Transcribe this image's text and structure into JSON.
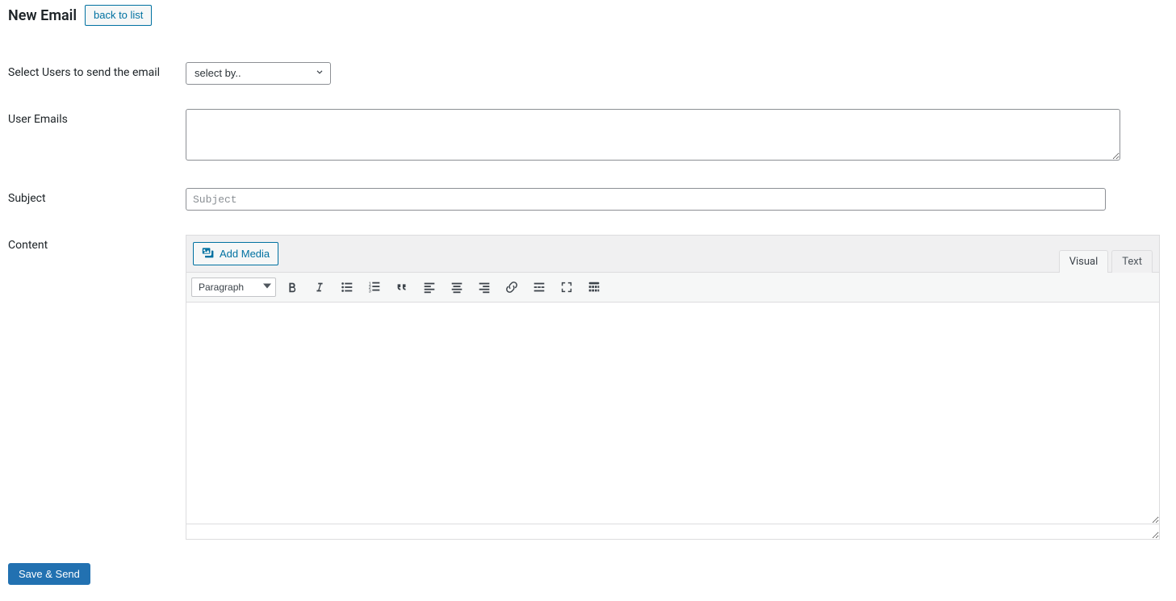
{
  "header": {
    "title": "New Email",
    "back_label": "back to list"
  },
  "fields": {
    "select_users_label": "Select Users to send the email",
    "select_users_placeholder": "select by..",
    "user_emails_label": "User Emails",
    "user_emails_value": "",
    "subject_label": "Subject",
    "subject_placeholder": "Subject",
    "subject_value": "",
    "content_label": "Content"
  },
  "editor": {
    "add_media_label": "Add Media",
    "tabs": {
      "visual": "Visual",
      "text": "Text",
      "active": "visual"
    },
    "paragraph_label": "Paragraph",
    "body": ""
  },
  "icons": {
    "bold": "bold-icon",
    "italic": "italic-icon",
    "bulleted_list": "bulleted-list-icon",
    "numbered_list": "numbered-list-icon",
    "blockquote": "blockquote-icon",
    "align_left": "align-left-icon",
    "align_center": "align-center-icon",
    "align_right": "align-right-icon",
    "link": "link-icon",
    "read_more": "read-more-icon",
    "fullscreen": "fullscreen-icon",
    "toolbar_toggle": "toolbar-toggle-icon"
  },
  "actions": {
    "submit_label": "Save & Send"
  },
  "colors": {
    "link": "#0071a1",
    "primary": "#2271b1",
    "border": "#8c8f94",
    "panel": "#f0f0f1"
  }
}
